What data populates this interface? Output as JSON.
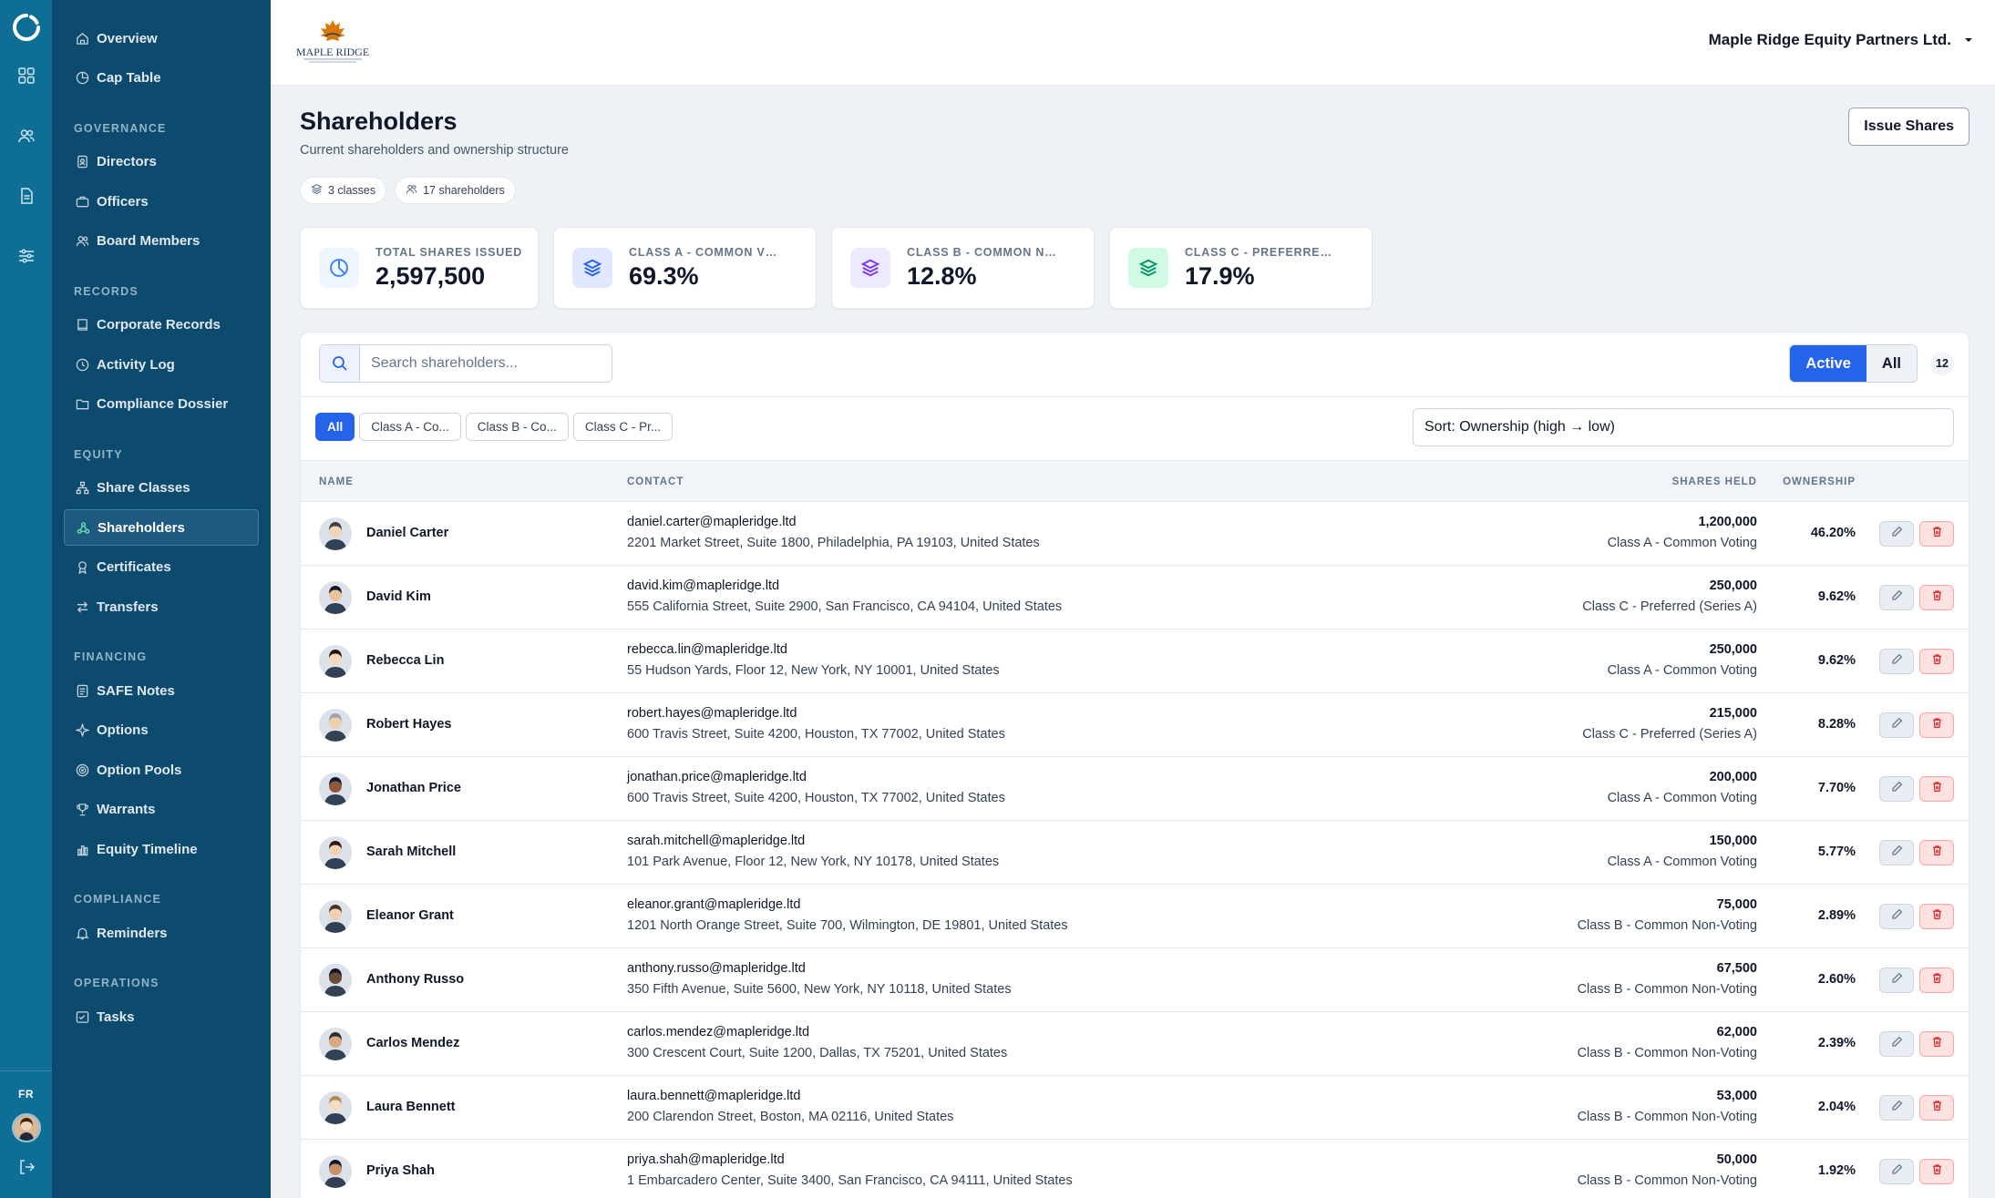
{
  "rail": {
    "icons": [
      "home-grid-icon",
      "users-icon",
      "document-icon",
      "sliders-icon"
    ],
    "language": "FR"
  },
  "sidebar": {
    "top_items": [
      {
        "label": "Overview",
        "icon": "home-icon"
      },
      {
        "label": "Cap Table",
        "icon": "pie-chart-icon"
      }
    ],
    "sections": [
      {
        "title": "GOVERNANCE",
        "items": [
          {
            "label": "Directors",
            "icon": "id-badge-icon"
          },
          {
            "label": "Officers",
            "icon": "briefcase-icon"
          },
          {
            "label": "Board Members",
            "icon": "users-icon"
          }
        ]
      },
      {
        "title": "RECORDS",
        "items": [
          {
            "label": "Corporate Records",
            "icon": "book-icon"
          },
          {
            "label": "Activity Log",
            "icon": "clock-icon"
          },
          {
            "label": "Compliance Dossier",
            "icon": "folder-icon"
          }
        ]
      },
      {
        "title": "EQUITY",
        "items": [
          {
            "label": "Share Classes",
            "icon": "hierarchy-icon"
          },
          {
            "label": "Shareholders",
            "icon": "share-icon",
            "active": true
          },
          {
            "label": "Certificates",
            "icon": "certificate-icon"
          },
          {
            "label": "Transfers",
            "icon": "transfer-icon"
          }
        ]
      },
      {
        "title": "FINANCING",
        "items": [
          {
            "label": "SAFE Notes",
            "icon": "note-icon"
          },
          {
            "label": "Options",
            "icon": "sparkle-icon"
          },
          {
            "label": "Option Pools",
            "icon": "target-icon"
          },
          {
            "label": "Warrants",
            "icon": "trophy-icon"
          },
          {
            "label": "Equity Timeline",
            "icon": "bar-chart-icon"
          }
        ]
      },
      {
        "title": "COMPLIANCE",
        "items": [
          {
            "label": "Reminders",
            "icon": "bell-icon"
          }
        ]
      },
      {
        "title": "OPERATIONS",
        "items": [
          {
            "label": "Tasks",
            "icon": "checklist-icon"
          }
        ]
      }
    ]
  },
  "topbar": {
    "logo_text": "MAPLE RIDGE",
    "company_name": "Maple Ridge Equity Partners Ltd."
  },
  "page": {
    "title": "Shareholders",
    "subtitle": "Current shareholders and ownership structure",
    "chips": [
      "3 classes",
      "17 shareholders"
    ],
    "issue_button": "Issue Shares"
  },
  "stats": [
    {
      "label": "TOTAL SHARES ISSUED",
      "value": "2,597,500",
      "icon": "pie-chart-icon",
      "color": "#3b82f6",
      "bg": "#eff6ff"
    },
    {
      "label": "CLASS A - COMMON VO...",
      "value": "69.3%",
      "icon": "layers-icon",
      "color": "#2563eb",
      "bg": "#e0e7ff"
    },
    {
      "label": "CLASS B - COMMON NO...",
      "value": "12.8%",
      "icon": "layers-icon",
      "color": "#7c3aed",
      "bg": "#ede9fe"
    },
    {
      "label": "CLASS C - PREFERRED (S...",
      "value": "17.9%",
      "icon": "layers-icon",
      "color": "#059669",
      "bg": "#d1fae5"
    }
  ],
  "table": {
    "search_placeholder": "Search shareholders...",
    "toggle": {
      "active": "Active",
      "all": "All"
    },
    "count": "12",
    "filters": [
      "All",
      "Class A - Co...",
      "Class B - Co...",
      "Class C - Pr..."
    ],
    "sort": "Sort: Ownership (high → low)",
    "headers": {
      "name": "NAME",
      "contact": "CONTACT",
      "shares": "SHARES HELD",
      "ownership": "OWNERSHIP"
    },
    "rows": [
      {
        "name": "Daniel Carter",
        "email": "daniel.carter@mapleridge.ltd",
        "address": "2201 Market Street, Suite 1800, Philadelphia, PA 19103, United States",
        "shares": "1,200,000",
        "class": "Class A - Common Voting",
        "ownership": "46.20%"
      },
      {
        "name": "David Kim",
        "email": "david.kim@mapleridge.ltd",
        "address": "555 California Street, Suite 2900, San Francisco, CA 94104, United States",
        "shares": "250,000",
        "class": "Class C - Preferred (Series A)",
        "ownership": "9.62%"
      },
      {
        "name": "Rebecca Lin",
        "email": "rebecca.lin@mapleridge.ltd",
        "address": "55 Hudson Yards, Floor 12, New York, NY 10001, United States",
        "shares": "250,000",
        "class": "Class A - Common Voting",
        "ownership": "9.62%"
      },
      {
        "name": "Robert Hayes",
        "email": "robert.hayes@mapleridge.ltd",
        "address": "600 Travis Street, Suite 4200, Houston, TX 77002, United States",
        "shares": "215,000",
        "class": "Class C - Preferred (Series A)",
        "ownership": "8.28%"
      },
      {
        "name": "Jonathan Price",
        "email": "jonathan.price@mapleridge.ltd",
        "address": "600 Travis Street, Suite 4200, Houston, TX 77002, United States",
        "shares": "200,000",
        "class": "Class A - Common Voting",
        "ownership": "7.70%"
      },
      {
        "name": "Sarah Mitchell",
        "email": "sarah.mitchell@mapleridge.ltd",
        "address": "101 Park Avenue, Floor 12, New York, NY 10178, United States",
        "shares": "150,000",
        "class": "Class A - Common Voting",
        "ownership": "5.77%"
      },
      {
        "name": "Eleanor Grant",
        "email": "eleanor.grant@mapleridge.ltd",
        "address": "1201 North Orange Street, Suite 700, Wilmington, DE 19801, United States",
        "shares": "75,000",
        "class": "Class B - Common Non-Voting",
        "ownership": "2.89%"
      },
      {
        "name": "Anthony Russo",
        "email": "anthony.russo@mapleridge.ltd",
        "address": "350 Fifth Avenue, Suite 5600, New York, NY 10118, United States",
        "shares": "67,500",
        "class": "Class B - Common Non-Voting",
        "ownership": "2.60%"
      },
      {
        "name": "Carlos Mendez",
        "email": "carlos.mendez@mapleridge.ltd",
        "address": "300 Crescent Court, Suite 1200, Dallas, TX 75201, United States",
        "shares": "62,000",
        "class": "Class B - Common Non-Voting",
        "ownership": "2.39%"
      },
      {
        "name": "Laura Bennett",
        "email": "laura.bennett@mapleridge.ltd",
        "address": "200 Clarendon Street, Boston, MA 02116, United States",
        "shares": "53,000",
        "class": "Class B - Common Non-Voting",
        "ownership": "2.04%"
      },
      {
        "name": "Priya Shah",
        "email": "priya.shah@mapleridge.ltd",
        "address": "1 Embarcadero Center, Suite 3400, San Francisco, CA 94111, United States",
        "shares": "50,000",
        "class": "Class B - Common Non-Voting",
        "ownership": "1.92%"
      }
    ]
  }
}
